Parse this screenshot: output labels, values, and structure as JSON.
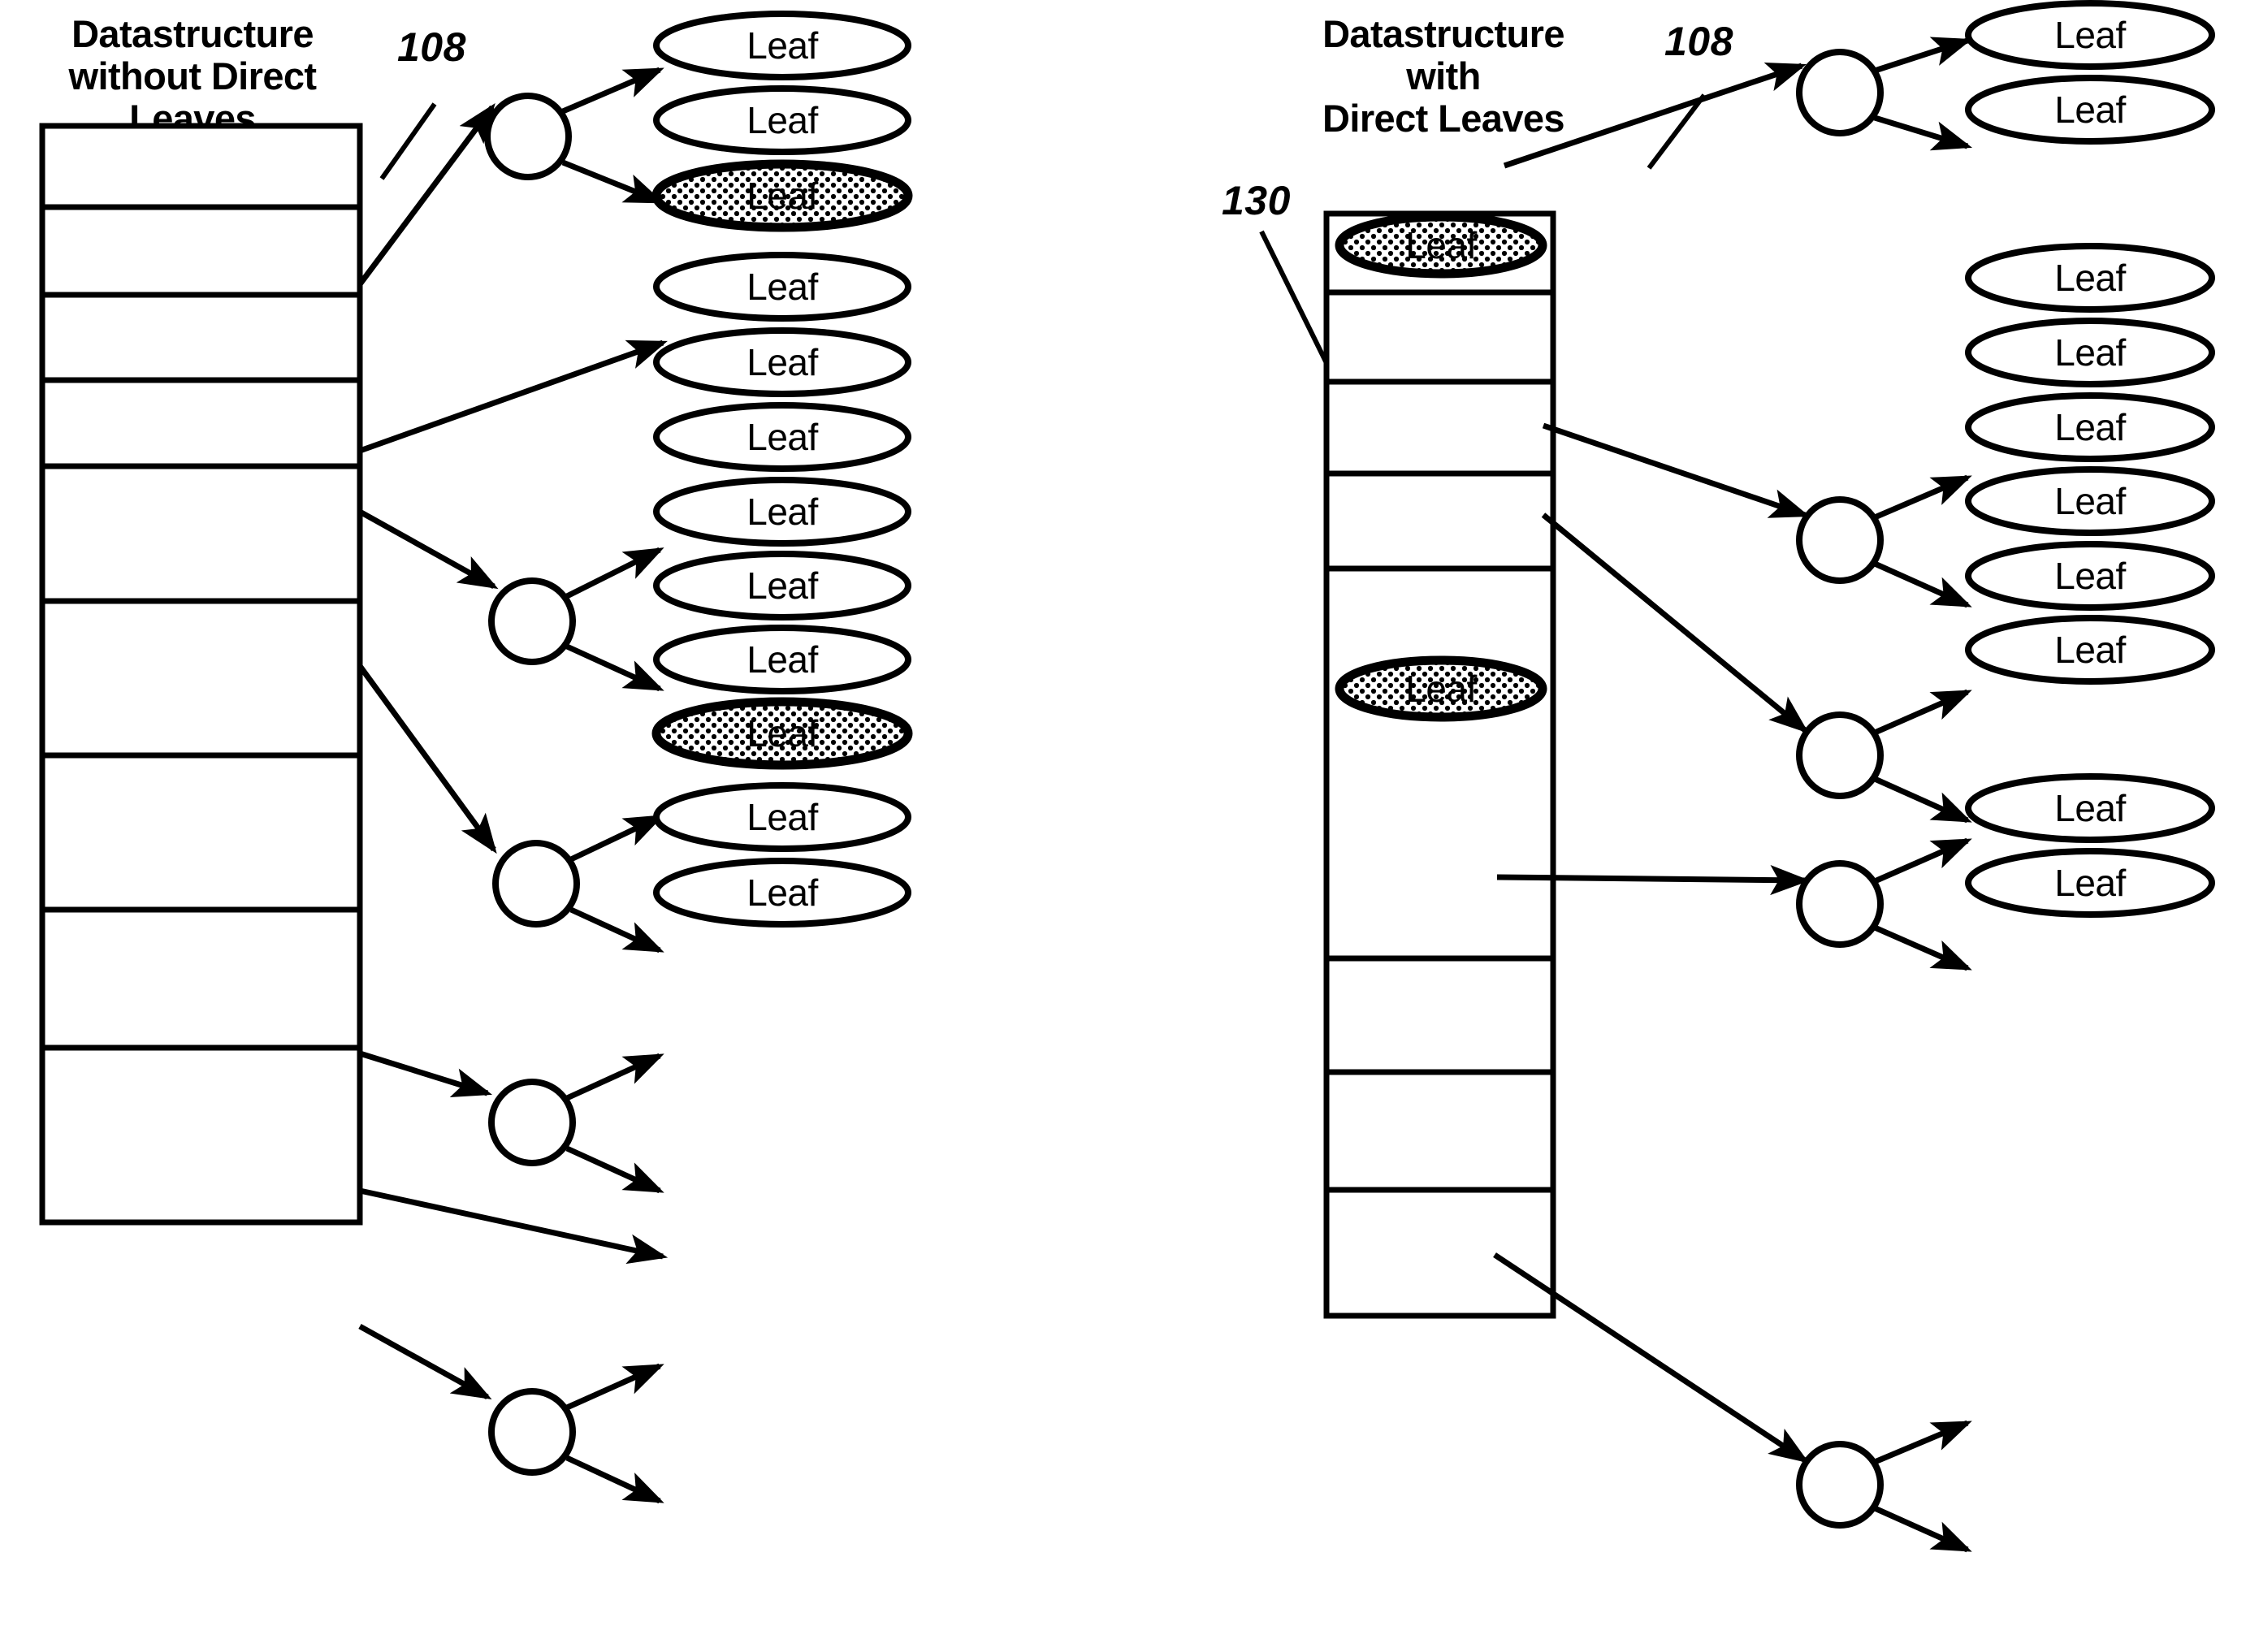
{
  "figure": {
    "background_color": "#ffffff",
    "line_color": "#000000"
  },
  "panels": [
    {
      "id": "left",
      "title_lines": [
        "Datastructure",
        "without Direct",
        "Leaves"
      ],
      "reference_number": "108",
      "table": {
        "row_count": 9,
        "rows": [
          {
            "index": 0,
            "content": ""
          },
          {
            "index": 1,
            "content": ""
          },
          {
            "index": 2,
            "content": ""
          },
          {
            "index": 3,
            "content": ""
          },
          {
            "index": 4,
            "content": ""
          },
          {
            "index": 5,
            "content": ""
          },
          {
            "index": 6,
            "content": ""
          },
          {
            "index": 7,
            "content": ""
          },
          {
            "index": 8,
            "content": ""
          }
        ]
      },
      "nodes": [
        {
          "id": "L-n1",
          "label": ""
        },
        {
          "id": "L-n2",
          "label": ""
        },
        {
          "id": "L-n3",
          "label": ""
        },
        {
          "id": "L-n4",
          "label": ""
        },
        {
          "id": "L-n5",
          "label": ""
        }
      ],
      "leaves": [
        {
          "id": "L-l1",
          "label": "Leaf",
          "shaded": false
        },
        {
          "id": "L-l2",
          "label": "Leaf",
          "shaded": false
        },
        {
          "id": "L-l3",
          "label": "Leaf",
          "shaded": true
        },
        {
          "id": "L-l4",
          "label": "Leaf",
          "shaded": false
        },
        {
          "id": "L-l5",
          "label": "Leaf",
          "shaded": false
        },
        {
          "id": "L-l6",
          "label": "Leaf",
          "shaded": false
        },
        {
          "id": "L-l7",
          "label": "Leaf",
          "shaded": false
        },
        {
          "id": "L-l8",
          "label": "Leaf",
          "shaded": false
        },
        {
          "id": "L-l9",
          "label": "Leaf",
          "shaded": false
        },
        {
          "id": "L-l10",
          "label": "Leaf",
          "shaded": true
        },
        {
          "id": "L-l11",
          "label": "Leaf",
          "shaded": false
        },
        {
          "id": "L-l12",
          "label": "Leaf",
          "shaded": false
        }
      ]
    },
    {
      "id": "right",
      "title_lines": [
        "Datastructure",
        "with",
        "Direct Leaves"
      ],
      "reference_number": "108",
      "direct_leaf_reference_number": "130",
      "table": {
        "row_count": 8,
        "rows": [
          {
            "index": 0,
            "content": ""
          },
          {
            "index": 1,
            "content": "Leaf",
            "shaded": true
          },
          {
            "index": 2,
            "content": ""
          },
          {
            "index": 3,
            "content": ""
          },
          {
            "index": 4,
            "content": ""
          },
          {
            "index": 5,
            "content": ""
          },
          {
            "index": 6,
            "content": "Leaf",
            "shaded": true
          },
          {
            "index": 7,
            "content": ""
          }
        ]
      },
      "nodes": [
        {
          "id": "R-n1",
          "label": ""
        },
        {
          "id": "R-n2",
          "label": ""
        },
        {
          "id": "R-n3",
          "label": ""
        },
        {
          "id": "R-n4",
          "label": ""
        },
        {
          "id": "R-n5",
          "label": ""
        }
      ],
      "leaves": [
        {
          "id": "R-l1",
          "label": "Leaf",
          "shaded": false
        },
        {
          "id": "R-l2",
          "label": "Leaf",
          "shaded": false
        },
        {
          "id": "R-l3",
          "label": "Leaf",
          "shaded": false
        },
        {
          "id": "R-l4",
          "label": "Leaf",
          "shaded": false
        },
        {
          "id": "R-l5",
          "label": "Leaf",
          "shaded": false
        },
        {
          "id": "R-l6",
          "label": "Leaf",
          "shaded": false
        },
        {
          "id": "R-l7",
          "label": "Leaf",
          "shaded": false
        },
        {
          "id": "R-l8",
          "label": "Leaf",
          "shaded": false
        },
        {
          "id": "R-l9",
          "label": "Leaf",
          "shaded": false
        },
        {
          "id": "R-l10",
          "label": "Leaf",
          "shaded": false
        }
      ],
      "inline_leaves": [
        {
          "id": "R-il1",
          "label": "Leaf",
          "shaded": true
        },
        {
          "id": "R-il2",
          "label": "Leaf",
          "shaded": true
        }
      ]
    }
  ]
}
